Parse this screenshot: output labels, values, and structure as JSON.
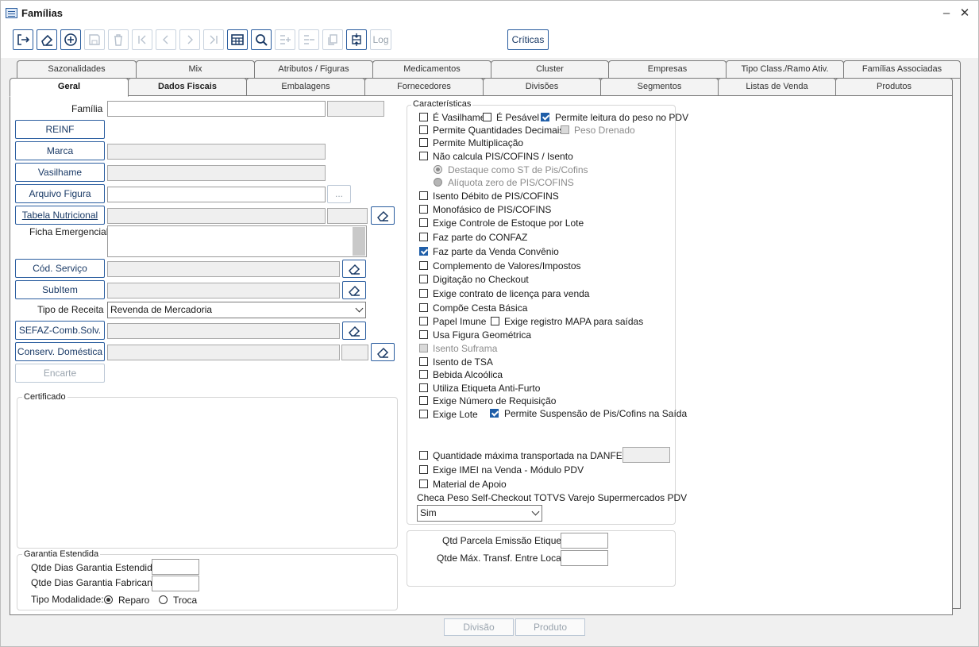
{
  "window": {
    "title": "Famílias",
    "minimize": "–",
    "close": "✕"
  },
  "toolbar": {
    "log_label": "Log",
    "criticas_label": "Críticas"
  },
  "tabs_back": [
    "Sazonalidades",
    "Mix",
    "Atributos / Figuras",
    "Medicamentos",
    "Cluster",
    "Empresas",
    "Tipo Class./Ramo Ativ.",
    "Famílias Associadas"
  ],
  "tabs_front": [
    "Geral",
    "Dados Fiscais",
    "Embalagens",
    "Fornecedores",
    "Divisões",
    "Segmentos",
    "Listas de Venda",
    "Produtos"
  ],
  "left": {
    "familia_label": "Família",
    "reinf": "REINF",
    "marca": "Marca",
    "vasilhame": "Vasilhame",
    "arquivo_figura": "Arquivo Figura",
    "browse": "...",
    "tabela_nutricional": "Tabela Nutricional",
    "ficha_emergencial": "Ficha Emergencial",
    "cod_servico": "Cód. Serviço",
    "subitem": "SubItem",
    "tipo_receita_label": "Tipo de Receita",
    "tipo_receita_value": "Revenda de Mercadoria",
    "sefaz": "SEFAZ-Comb.Solv.",
    "conserv": "Conserv. Doméstica",
    "encarte": "Encarte",
    "certificado": "Certificado"
  },
  "garantia": {
    "title": "Garantia Estendida",
    "dias_estendida": "Qtde Dias Garantia Estendida",
    "dias_fabricante": "Qtde Dias Garantia Fabricante",
    "tipo_modalidade": "Tipo Modalidade:",
    "reparo": "Reparo",
    "troca": "Troca"
  },
  "caracteristicas": {
    "title": "Características",
    "items": {
      "vasilhame": "É Vasilhame",
      "pesavel": "É Pesável",
      "leitura_peso": "Permite leitura do peso no PDV",
      "qtd_decimais": "Permite Quantidades Decimais",
      "peso_drenado": "Peso Drenado",
      "multiplicacao": "Permite Multiplicação",
      "nao_calcula": "Não calcula PIS/COFINS / Isento",
      "destaque_st": "Destaque como ST de Pis/Cofins",
      "aliquota_zero": "Alíquota zero de PIS/COFINS",
      "isento_debito": "Isento Débito de PIS/COFINS",
      "monofasico": "Monofásico de PIS/COFINS",
      "controle_lote": "Exige Controle de Estoque por Lote",
      "confaz": "Faz parte do CONFAZ",
      "venda_convenio": "Faz parte da Venda Convênio",
      "complemento": "Complemento de Valores/Impostos",
      "digitacao": "Digitação no Checkout",
      "contrato": "Exige contrato de licença para venda",
      "cesta_basica": "Compõe Cesta Básica",
      "papel_imune": "Papel Imune",
      "mapa": "Exige registro MAPA para saídas",
      "figura_geometrica": "Usa Figura Geométrica",
      "isento_suframa": "Isento Suframa",
      "isento_tsa": "Isento de TSA",
      "bebida": "Bebida Alcoólica",
      "antifurto": "Utiliza Etiqueta Anti-Furto",
      "requisicao": "Exige Número de Requisição",
      "exige_lote": "Exige Lote",
      "suspensao": "Permite Suspensão de Pis/Cofins na Saída",
      "qtd_danfe": "Quantidade máxima transportada na DANFE (KG)",
      "imei": "Exige IMEI na Venda - Módulo PDV",
      "apoio": "Material de Apoio"
    },
    "checa_peso_label": "Checa Peso Self-Checkout TOTVS Varejo Supermercados PDV",
    "checa_peso_value": "Sim"
  },
  "extra": {
    "qtd_parcela": "Qtd Parcela Emissão Etiqueta",
    "qtd_max_transf": "Qtde Máx. Transf. Entre Locais"
  },
  "bottom": {
    "divisao": "Divisão",
    "produto": "Produto"
  }
}
